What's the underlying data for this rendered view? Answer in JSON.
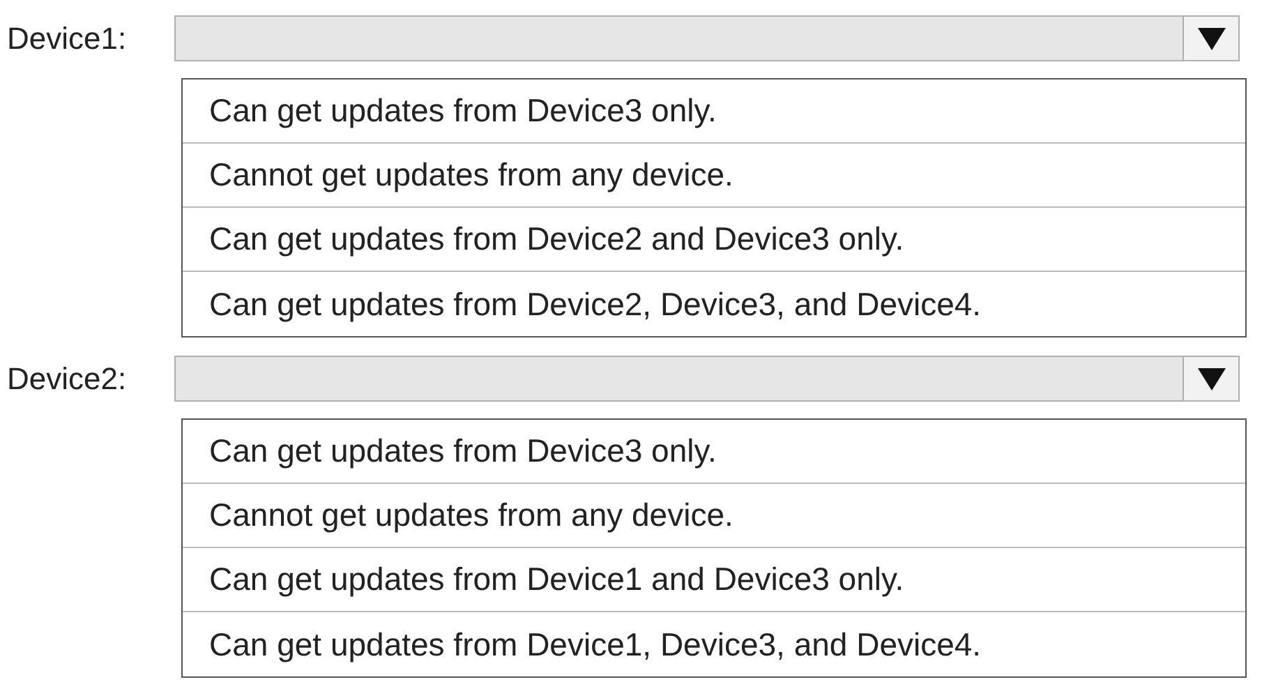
{
  "dropdowns": [
    {
      "label": "Device1:",
      "options": [
        "Can get updates from Device3 only.",
        "Cannot get updates from any device.",
        "Can get updates from Device2 and Device3 only.",
        "Can get updates from Device2, Device3, and Device4."
      ]
    },
    {
      "label": "Device2:",
      "options": [
        "Can get updates from Device3 only.",
        "Cannot get updates from any device.",
        "Can get updates from Device1 and Device3 only.",
        "Can get updates from Device1, Device3, and Device4."
      ]
    }
  ]
}
